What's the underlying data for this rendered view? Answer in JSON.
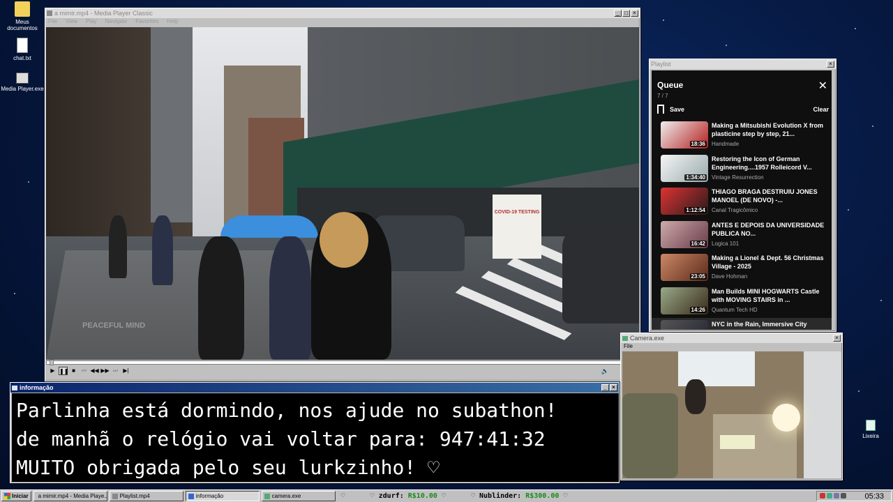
{
  "desktop": {
    "icons": [
      {
        "label": "Meus documentos",
        "icon": "folder-icon"
      },
      {
        "label": "chat.txt",
        "icon": "text-file-icon"
      },
      {
        "label": "Media Player.exe",
        "icon": "media-player-icon"
      },
      {
        "label": "Lixeira",
        "icon": "recycle-bin-icon"
      }
    ]
  },
  "mpc": {
    "title": "a mimir.mp4 - Media Player Classic",
    "menu": [
      "File",
      "View",
      "Play",
      "Navigate",
      "Favorites",
      "Help"
    ],
    "watermark": "PEACEFUL MIND",
    "booth_sign": "COVID-19 TESTING",
    "seek_position": 0.0
  },
  "playlist": {
    "window_title": "Playlist",
    "header": "Queue",
    "count": "7 / 7",
    "save_label": "Save",
    "clear_label": "Clear",
    "items": [
      {
        "title": "Making a Mitsubishi Evolution X from plasticine step by step, 21...",
        "channel": "Handmade",
        "duration": "18:36",
        "thumb": "#b51e1e"
      },
      {
        "title": "Restoring the Icon of German Engineering....1957 Rolleicord V...",
        "channel": "Vintage Resurrection",
        "duration": "1:34:40",
        "thumb": "#d9d9d9"
      },
      {
        "title": "THIAGO BRAGA DESTRUIU JONES MANOEL (DE NOVO) -...",
        "channel": "Canal Tragicômico",
        "duration": "1:12:54",
        "thumb": "#7a2a1f"
      },
      {
        "title": "ANTES E DEPOIS DA UNIVERSIDADE PUBLICA NO...",
        "channel": "Logica 101",
        "duration": "16:42",
        "thumb": "#6a3b4a"
      },
      {
        "title": "Making a Lionel & Dept. 56 Christmas Village - 2025",
        "channel": "Dave Hohman",
        "duration": "23:05",
        "thumb": "#8a4a2a"
      },
      {
        "title": "Man Builds MINI HOGWARTS Castle with MOVING STAIRS in ...",
        "channel": "Quantum Tech HD",
        "duration": "14:26",
        "thumb": "#5a4a3a"
      },
      {
        "title": "NYC in the Rain, Immersive City Soundscape",
        "channel": "",
        "duration": "",
        "thumb": "#3a3f46"
      }
    ]
  },
  "info": {
    "title": "informação",
    "lines": [
      "Parlinha está dormindo, nos ajude no subathon!",
      "de manhã o relógio vai voltar para:  947:41:32",
      "MUITO obrigada pelo seu lurkzinho! ♡"
    ]
  },
  "camera": {
    "title": "Camera.exe",
    "menu": "File"
  },
  "taskbar": {
    "start_label": "Iniciar",
    "items": [
      {
        "label": "a mimir.mp4 - Media Playe...",
        "pressed": false
      },
      {
        "label": "Playlist.mp4",
        "pressed": false
      },
      {
        "label": "informação",
        "pressed": true
      },
      {
        "label": "camera.exe",
        "pressed": false
      }
    ],
    "donors": [
      {
        "name": "zdurf:",
        "amount": "R$10.00"
      },
      {
        "name": "Nublinder:",
        "amount": "R$300.00"
      }
    ],
    "clock": "05:33"
  }
}
